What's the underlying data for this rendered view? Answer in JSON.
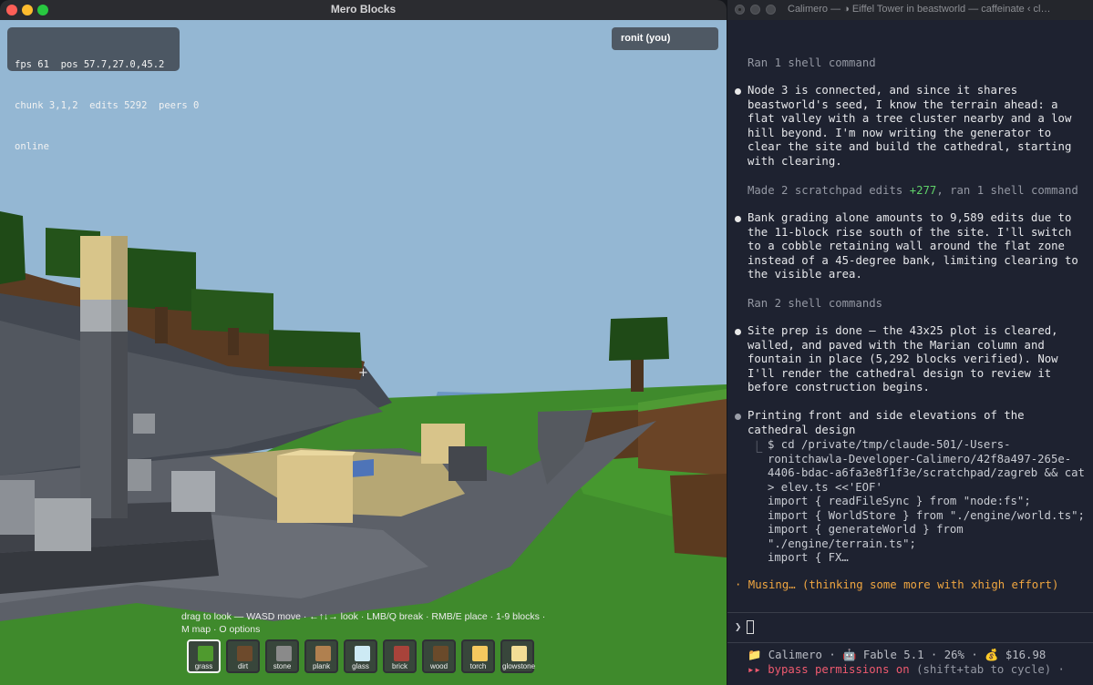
{
  "game": {
    "window_title": "Mero Blocks",
    "hud": {
      "line1": "fps 61  pos 57.7,27.0,45.2",
      "line2": "chunk 3,1,2  edits 5292  peers 0",
      "line3": "online"
    },
    "player_tag": "ronit (you)",
    "hint": "drag to look — WASD move · ←↑↓→ look · LMB/Q break · RMB/E place · 1-9 blocks · M map · O options",
    "hotbar": [
      {
        "label": "grass",
        "color": "#4f9a2e",
        "selected": true
      },
      {
        "label": "dirt",
        "color": "#6d4a2c",
        "selected": false
      },
      {
        "label": "stone",
        "color": "#8a8a8a",
        "selected": false
      },
      {
        "label": "plank",
        "color": "#b0804f",
        "selected": false
      },
      {
        "label": "glass",
        "color": "#cdeaf4",
        "selected": false
      },
      {
        "label": "brick",
        "color": "#a8433a",
        "selected": false
      },
      {
        "label": "wood",
        "color": "#6a4a2a",
        "selected": false
      },
      {
        "label": "torch",
        "color": "#f5c95e",
        "selected": false
      },
      {
        "label": "glowstone",
        "color": "#f2dd95",
        "selected": false
      }
    ]
  },
  "terminal": {
    "window_title": "Calimero — ◑ Eiffel Tower in beastworld — caffeinate ‹ cl…",
    "ran1": "Ran 1 shell command",
    "msg1": "Node 3 is connected, and since it shares beastworld's seed, I know the terrain ahead: a flat valley with a tree cluster nearby and a low hill beyond. I'm now writing the generator to clear the site and build the cathedral, starting with clearing.",
    "made_prefix": "Made 2 scratchpad edits ",
    "made_plus": "+277",
    "made_suffix": ", ran 1 shell command",
    "msg2": "Bank grading alone amounts to 9,589 edits due to the 11-block rise south of the site. I'll switch to a cobble retaining wall around the flat zone instead of a 45-degree bank, limiting clearing to the visible area.",
    "ran2": "Ran 2 shell commands",
    "msg3": "Site prep is done — the 43x25 plot is cleared, walled, and paved with the Marian column and fountain in place (5,292 blocks verified). Now I'll render the cathedral design to review it before construction begins.",
    "msg4": "Printing front and side elevations of the cathedral design",
    "code": "$ cd /private/tmp/claude-501/-Users-ronitchawla-Developer-Calimero/42f8a497-265e-4406-bdac-a6fa3e8f1f3e/scratchpad/zagreb && cat > elev.ts <<'EOF'\nimport { readFileSync } from \"node:fs\";\nimport { WorldStore } from \"./engine/world.ts\";\nimport { generateWorld } from \"./engine/terrain.ts\";\nimport { FX…",
    "musing": "· Musing… (thinking some more with xhigh effort)",
    "prompt_symbol": "❯",
    "status_line1": "📁 Calimero · 🤖 Fable 5.1 · 26% · 💰 $16.98",
    "status_bypass": "▸▸ bypass permissions on",
    "status_hint": " (shift+tab to cycle) ·"
  }
}
